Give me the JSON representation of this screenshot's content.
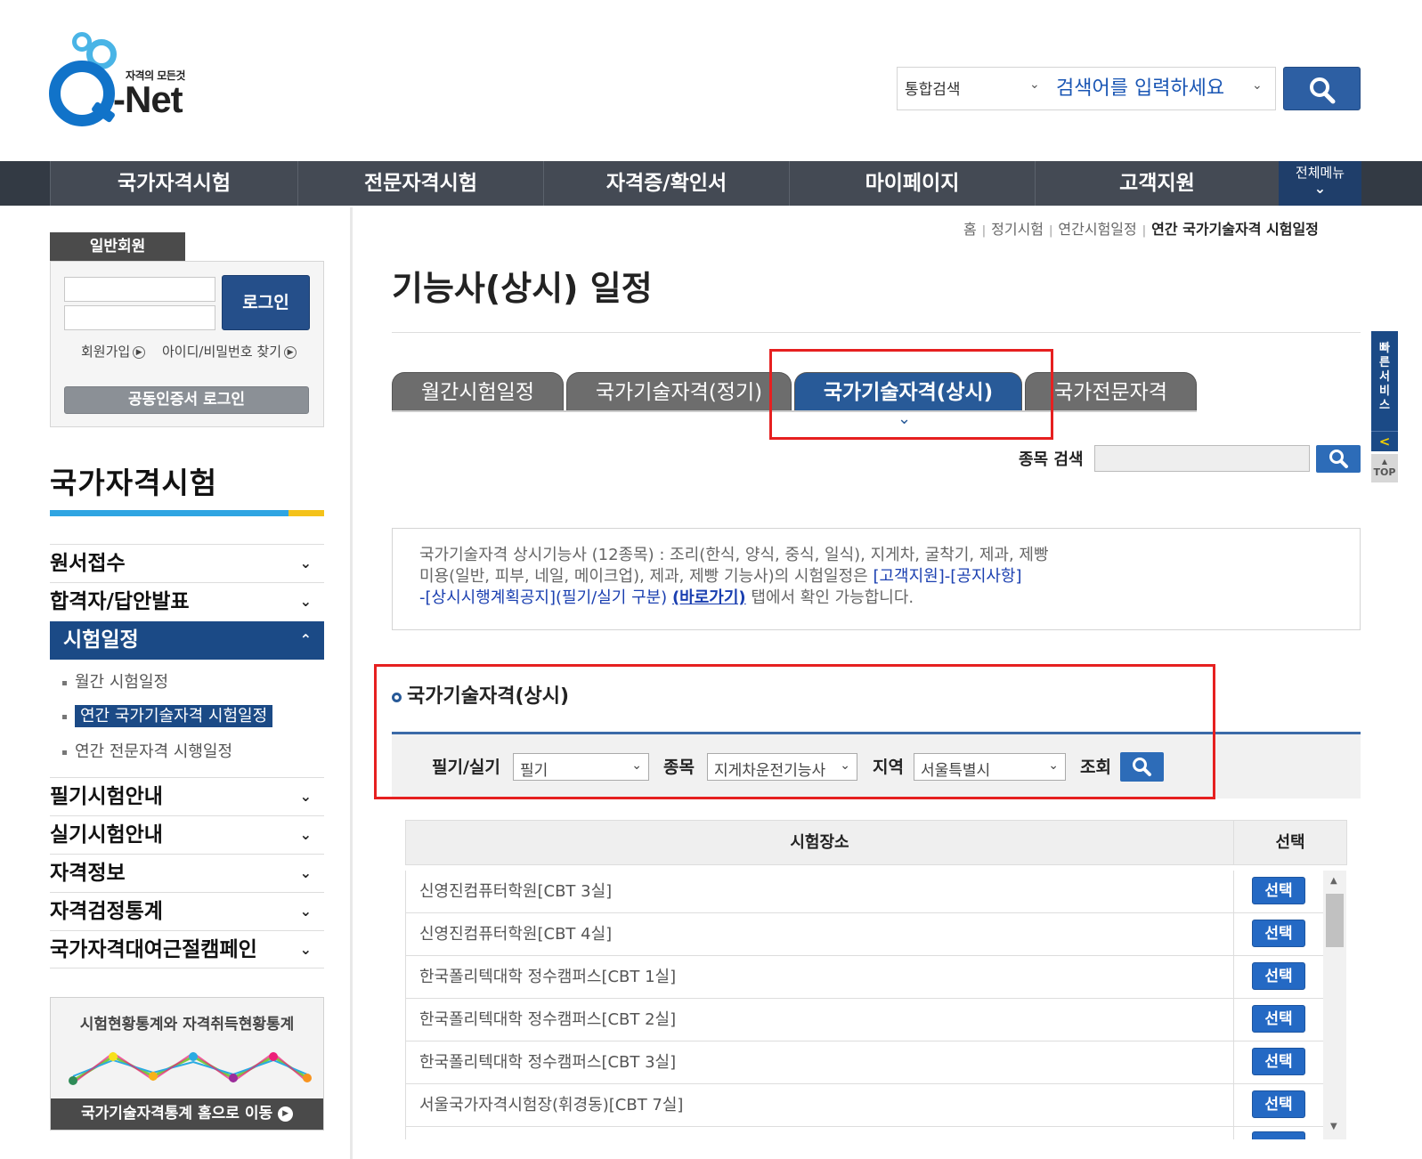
{
  "logo": {
    "tagline": "자격의 모든것",
    "name": "-Net"
  },
  "search": {
    "scope": "통합검색",
    "placeholder": "검색어를 입력하세요"
  },
  "nav": {
    "items": [
      "국가자격시험",
      "전문자격시험",
      "자격증/확인서",
      "마이페이지",
      "고객지원"
    ],
    "all_menu": "전체메뉴"
  },
  "login": {
    "tab": "일반회원",
    "button": "로그인",
    "join": "회원가입",
    "find": "아이디/비밀번호 찾기",
    "cert": "공동인증서 로그인"
  },
  "sidebar": {
    "title": "국가자격시험",
    "items": [
      {
        "label": "원서접수"
      },
      {
        "label": "합격자/답안발표"
      },
      {
        "label": "시험일정"
      },
      {
        "label": "필기시험안내"
      },
      {
        "label": "실기시험안내"
      },
      {
        "label": "자격정보"
      },
      {
        "label": "자격검정통계"
      },
      {
        "label": "국가자격대여근절캠페인"
      }
    ],
    "sub_items": [
      "월간 시험일정",
      "연간 국가기술자격 시험일정",
      "연간 전문자격 시행일정"
    ]
  },
  "stats": {
    "title": "시험현황통계와 자격취득현황통계",
    "link": "국가기술자격통계 홈으로 이동"
  },
  "breadcrumb": [
    "홈",
    "정기시험",
    "연간시험일정",
    "연간 국가기술자격 시험일정"
  ],
  "page": {
    "title": "기능사(상시) 일정"
  },
  "tabs": [
    "월간시험일정",
    "국가기술자격(정기)",
    "국가기술자격(상시)",
    "국가전문자격"
  ],
  "item_search": {
    "label": "종목 검색"
  },
  "notice": {
    "line1": "국가기술자격 상시기능사 (12종목) : 조리(한식, 양식, 중식, 일식), 지게차, 굴착기, 제과, 제빵",
    "line2_a": "미용(일반, 피부, 네일, 메이크업), 제과, 제빵 기능사)의 시험일정은 ",
    "line2_link": "[고객지원]-[공지사항]",
    "line3_link": "-[상시시행계획공지](필기/실기 구분)",
    "line3_b": " ",
    "line3_go": "(바로가기)",
    "line3_c": " 탭에서 확인 가능합니다."
  },
  "section": {
    "title": "국가기술자격(상시)"
  },
  "filters": {
    "type_label": "필기/실기",
    "type_value": "필기",
    "item_label": "종목",
    "item_value": "지게차운전기능사",
    "region_label": "지역",
    "region_value": "서울특별시",
    "query_label": "조회"
  },
  "table": {
    "headers": [
      "시험장소",
      "선택"
    ],
    "rows": [
      {
        "place": "신영진컴퓨터학원[CBT 3실]",
        "action": "선택"
      },
      {
        "place": "신영진컴퓨터학원[CBT 4실]",
        "action": "선택"
      },
      {
        "place": "한국폴리텍대학 정수캠퍼스[CBT 1실]",
        "action": "선택"
      },
      {
        "place": "한국폴리텍대학 정수캠퍼스[CBT 2실]",
        "action": "선택"
      },
      {
        "place": "한국폴리텍대학 정수캠퍼스[CBT 3실]",
        "action": "선택"
      },
      {
        "place": "서울국가자격시험장(휘경동)[CBT 7실]",
        "action": "선택"
      }
    ]
  },
  "quick_service": {
    "label": "빠른서비스",
    "top": "TOP"
  },
  "colors": {
    "nav_bg": "#333a44",
    "primary": "#285a98",
    "button_blue": "#2469c4",
    "highlight_red": "#e62020"
  }
}
